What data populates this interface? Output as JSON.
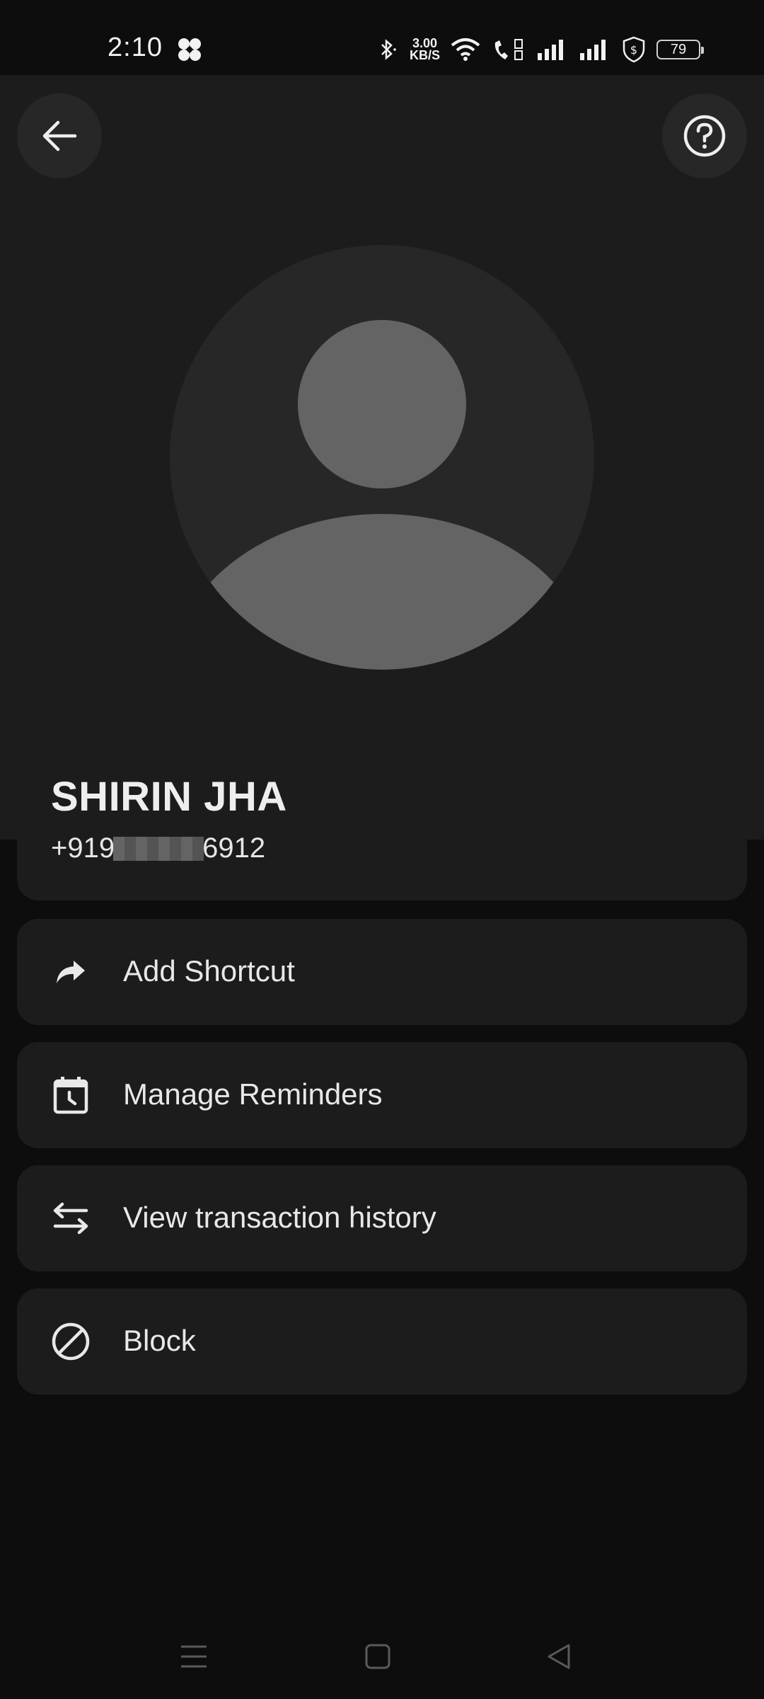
{
  "status_bar": {
    "time": "2:10",
    "net_speed_value": "3.00",
    "net_speed_unit": "KB/S",
    "battery": "79"
  },
  "header": {
    "back_icon": "arrow-left-icon",
    "help_icon": "help-circle-icon"
  },
  "contact": {
    "name": "SHIRIN JHA",
    "phone_prefix": "+919",
    "phone_suffix": "6912"
  },
  "actions": [
    {
      "label": "Add Shortcut",
      "icon": "share-arrow-icon"
    },
    {
      "label": "Manage Reminders",
      "icon": "calendar-clock-icon"
    },
    {
      "label": "View transaction history",
      "icon": "swap-arrows-icon"
    },
    {
      "label": "Block",
      "icon": "block-icon"
    }
  ],
  "nav": {
    "menu_icon": "menu-icon",
    "home_icon": "home-square-icon",
    "back_icon": "back-triangle-icon"
  },
  "colors": {
    "background": "#0d0d0d",
    "surface": "#1c1c1c",
    "avatar_bg": "#272727",
    "avatar_fg": "#646464",
    "text": "#e6e6e6"
  }
}
